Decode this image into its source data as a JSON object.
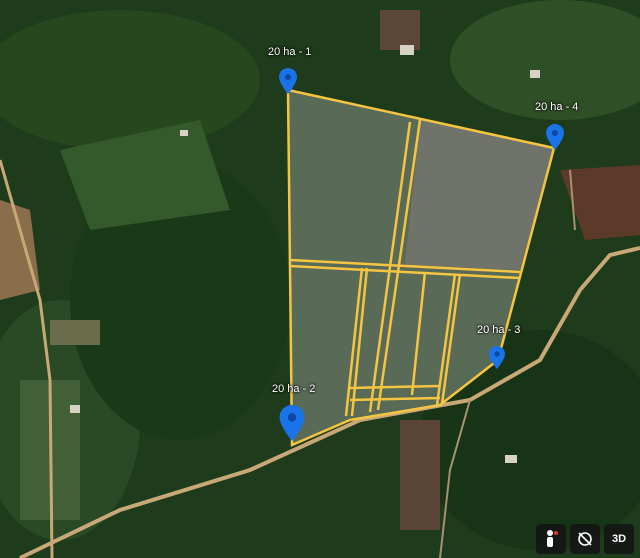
{
  "map": {
    "type": "satellite",
    "markers": [
      {
        "label": "20 ha - 1",
        "color": "#1a73e8"
      },
      {
        "label": "20 ha - 4",
        "color": "#1a73e8"
      },
      {
        "label": "20 ha - 3",
        "color": "#1a73e8"
      },
      {
        "label": "20 ha - 2",
        "color": "#1a73e8"
      }
    ],
    "parcel_outline_color": "#f5c542",
    "road_color": "#c9a877"
  },
  "controls": {
    "pegman_icon": "pegman-icon",
    "rotate_icon": "compass-off-icon",
    "toggle_3d_label": "3D"
  }
}
